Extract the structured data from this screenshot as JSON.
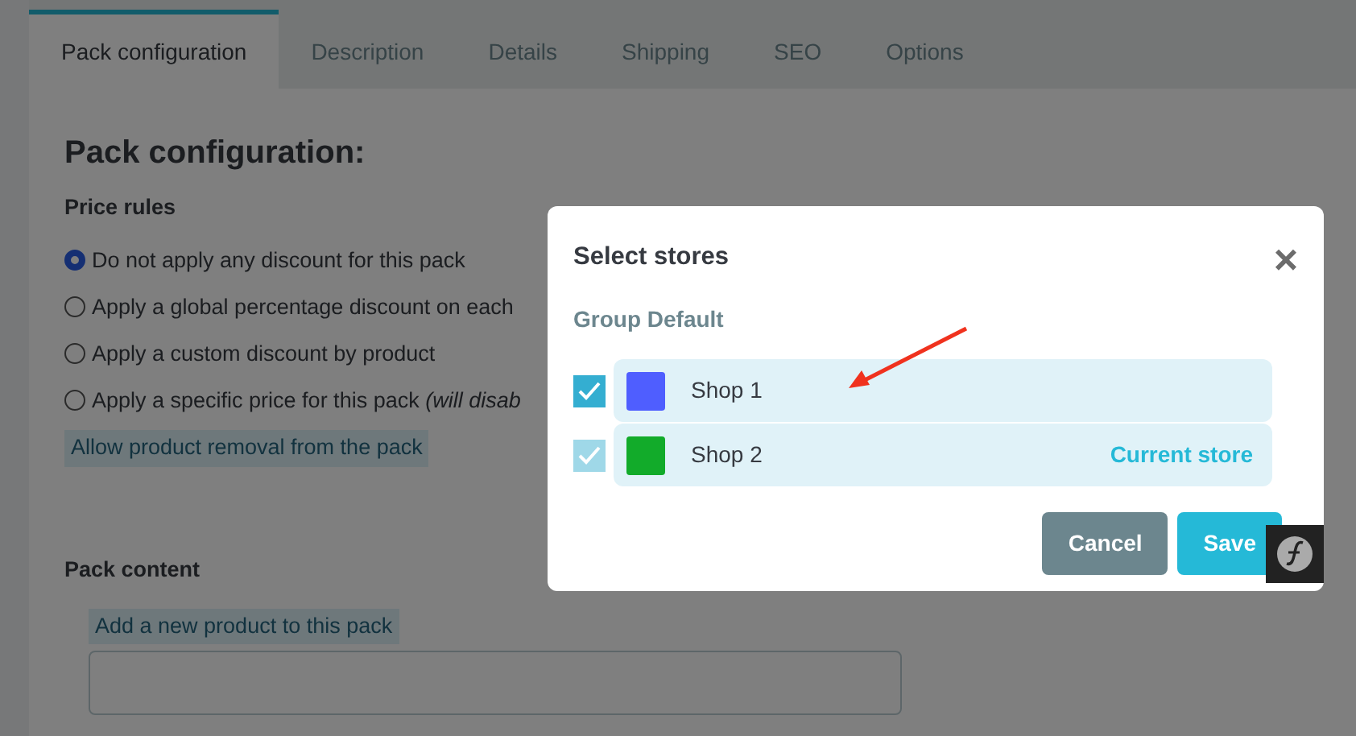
{
  "tabs": [
    {
      "label": "Pack configuration",
      "selected": true
    },
    {
      "label": "Description",
      "selected": false
    },
    {
      "label": "Details",
      "selected": false
    },
    {
      "label": "Shipping",
      "selected": false
    },
    {
      "label": "SEO",
      "selected": false
    },
    {
      "label": "Options",
      "selected": false
    }
  ],
  "heading": "Pack configuration:",
  "price_rules": {
    "title": "Price rules",
    "options": [
      {
        "label": "Do not apply any discount for this pack",
        "selected": true
      },
      {
        "label": "Apply a global percentage discount on each",
        "selected": false
      },
      {
        "label": "Apply a custom discount by product",
        "selected": false
      },
      {
        "label": "Apply a specific price for this pack *(will disab*",
        "selected": false
      }
    ],
    "link": "Allow product removal from the pack"
  },
  "pack_content": {
    "title": "Pack content",
    "link": "Add a new product to this pack"
  },
  "modal": {
    "title": "Select stores",
    "close": "×",
    "group": "Group Default",
    "stores": [
      {
        "name": "Shop 1",
        "checked": true,
        "disabled": false,
        "color": "#4f5eff"
      },
      {
        "name": "Shop 2",
        "checked": true,
        "disabled": true,
        "color": "#12ab2a",
        "note": "Current store"
      }
    ],
    "buttons": [
      {
        "label": "Cancel",
        "kind": "secondary"
      },
      {
        "label": "Save",
        "kind": "primary"
      }
    ]
  }
}
